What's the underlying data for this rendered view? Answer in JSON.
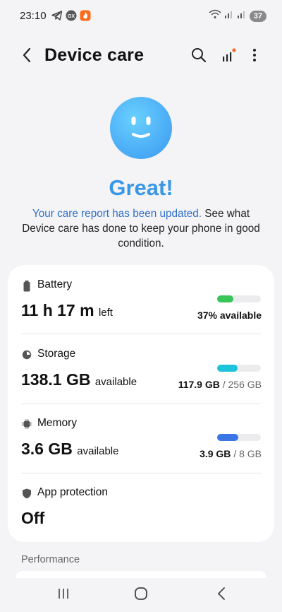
{
  "status_bar": {
    "time": "23:10",
    "notification_icons": [
      "telegram-icon",
      "gx-icon",
      "app-icon"
    ],
    "right_icons": [
      "wifi-icon",
      "signal-icon",
      "signal-icon"
    ],
    "battery": "37"
  },
  "header": {
    "title": "Device care",
    "icons": [
      "back-icon",
      "search-icon",
      "diagnostics-icon",
      "more-icon"
    ]
  },
  "hero": {
    "status": "Great!",
    "desc_link": "Your care report has been updated.",
    "desc_rest": " See what Device care has done to keep your phone in good condition."
  },
  "items": {
    "battery": {
      "label": "Battery",
      "value": "11 h 17 m",
      "value_suffix": "left",
      "right_text": "37% available",
      "level": 0.37,
      "color": "#39c45a"
    },
    "storage": {
      "label": "Storage",
      "value": "138.1 GB",
      "value_suffix": "available",
      "right_used": "117.9 GB",
      "right_total": "/ 256 GB",
      "level": 0.46,
      "color": "#1fc2db"
    },
    "memory": {
      "label": "Memory",
      "value": "3.6 GB",
      "value_suffix": "available",
      "right_used": "3.9 GB",
      "right_total": "/ 8 GB",
      "level": 0.49,
      "color": "#3a76e6"
    },
    "app_protection": {
      "label": "App protection",
      "value": "Off"
    }
  },
  "section": {
    "performance": "Performance"
  },
  "nav": {
    "icons": [
      "recents-icon",
      "home-icon",
      "back-nav-icon"
    ]
  }
}
